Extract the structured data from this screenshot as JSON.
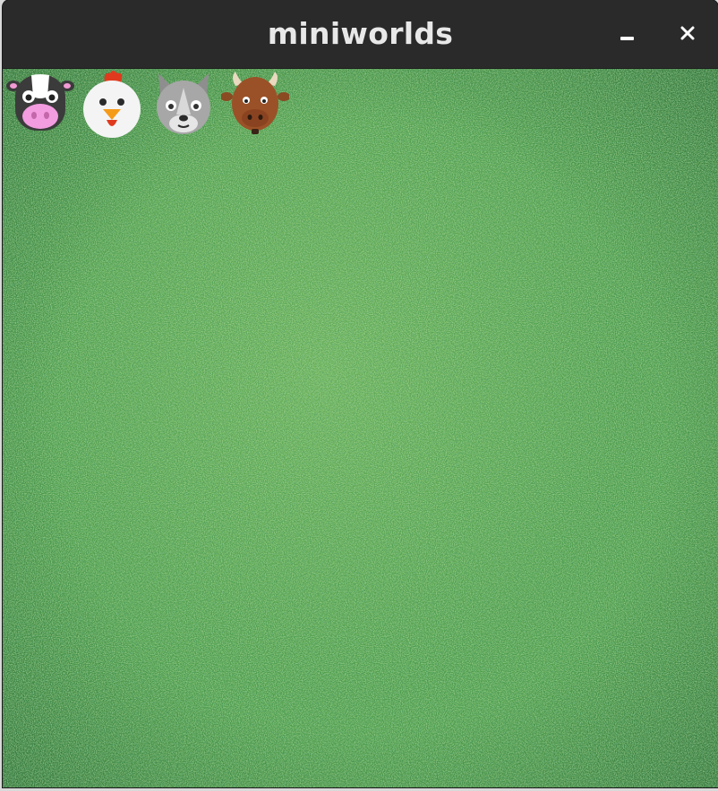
{
  "window": {
    "title": "miniworlds",
    "buttons": [
      "minimize-icon",
      "close-icon"
    ]
  },
  "canvas": {
    "background": "grass-texture",
    "colors": {
      "grass": "#4a9a48",
      "grass_light": "#9ccc6a",
      "grass_dark": "#1f6b3a"
    }
  },
  "actors": [
    {
      "name": "cow-icon"
    },
    {
      "name": "chicken-icon"
    },
    {
      "name": "wolf-icon"
    },
    {
      "name": "bull-icon"
    }
  ]
}
